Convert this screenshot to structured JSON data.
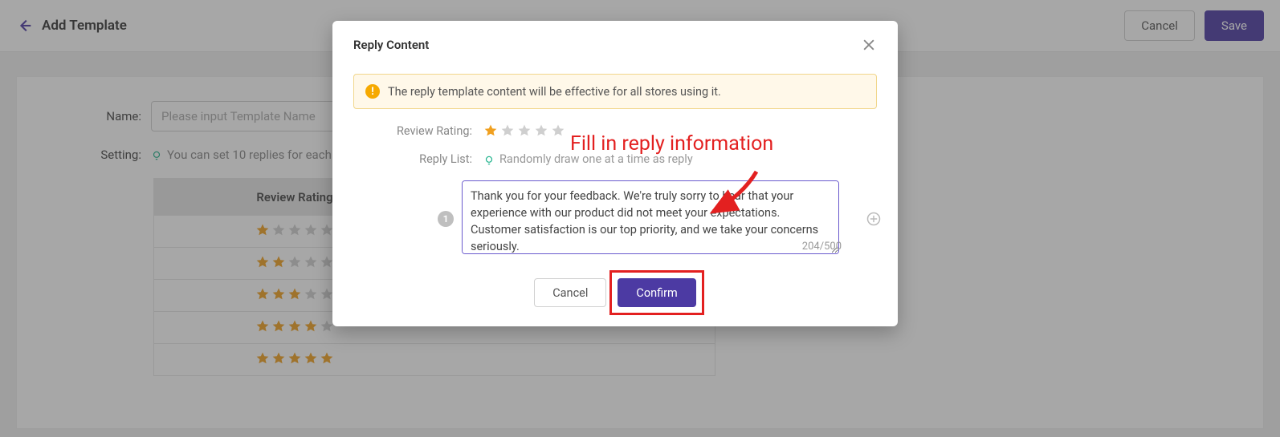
{
  "header": {
    "title": "Add Template",
    "cancel_label": "Cancel",
    "save_label": "Save"
  },
  "form": {
    "name_label": "Name:",
    "name_placeholder": "Please input Template Name",
    "setting_label": "Setting:",
    "setting_text": "You can set 10 replies for each",
    "table_header_rating": "Review Rating"
  },
  "modal": {
    "title": "Reply Content",
    "alert_text": "The reply template content will be effective for all stores using it.",
    "rating_label": "Review Rating:",
    "rating_value": 1,
    "list_label": "Reply List:",
    "list_hint": "Randomly draw one at a time as reply",
    "reply_index": "1",
    "reply_text": "Thank you for your feedback. We're truly sorry to hear that your experience with our product did not meet your expectations. Customer satisfaction is our top priority, and we take your concerns seriously.",
    "char_count": "204/500",
    "cancel_label": "Cancel",
    "confirm_label": "Confirm"
  },
  "annotation": {
    "text": "Fill in reply information"
  }
}
